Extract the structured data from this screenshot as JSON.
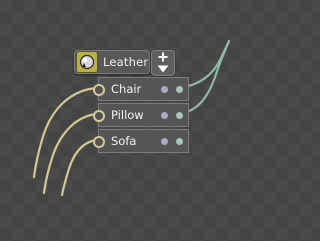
{
  "node": {
    "title": "Leather",
    "icon": "material-ball-icon",
    "add_button_icon": "plus-icon",
    "collapse_button_icon": "triangle-down-icon",
    "rows": [
      {
        "label": "Chair"
      },
      {
        "label": "Pillow"
      },
      {
        "label": "Sofa"
      }
    ]
  },
  "colors": {
    "input_wire": "#d3c891",
    "output_wire": "#8fb9a4",
    "icon_bg": "#b9b04a",
    "input_dot": "#d6c893",
    "mid_dot": "#a7aec2",
    "output_dot": "#a9c7b2",
    "row_bg": "#555555"
  }
}
